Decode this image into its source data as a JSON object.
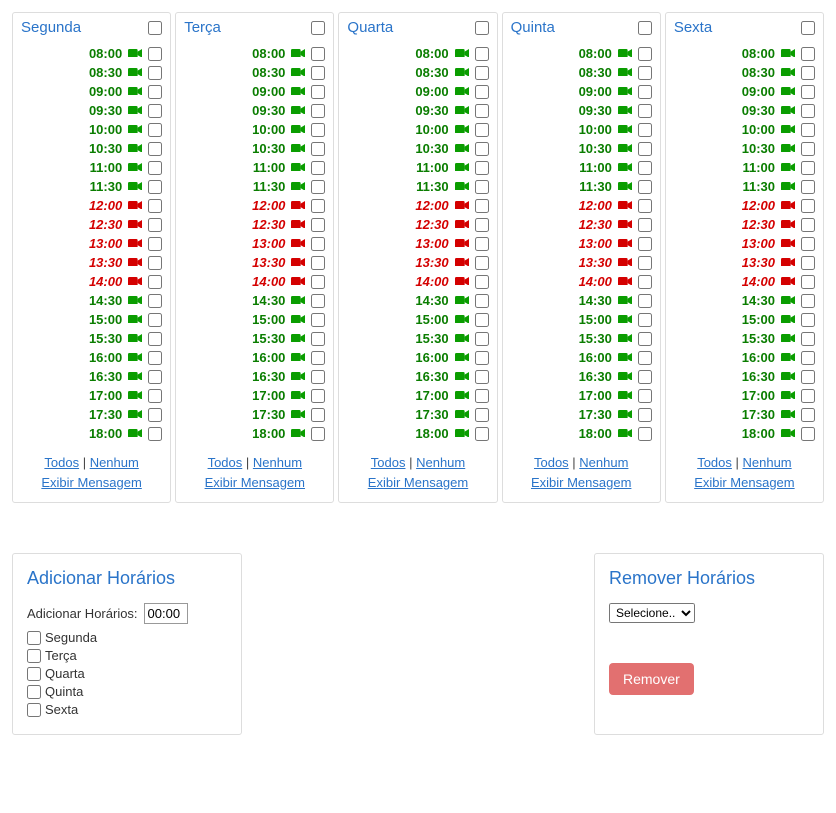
{
  "days": [
    {
      "key": "segunda",
      "label": "Segunda"
    },
    {
      "key": "terca",
      "label": "Terça"
    },
    {
      "key": "quarta",
      "label": "Quarta"
    },
    {
      "key": "quinta",
      "label": "Quinta"
    },
    {
      "key": "sexta",
      "label": "Sexta"
    }
  ],
  "slots": [
    {
      "time": "08:00",
      "status": "green"
    },
    {
      "time": "08:30",
      "status": "green"
    },
    {
      "time": "09:00",
      "status": "green"
    },
    {
      "time": "09:30",
      "status": "green"
    },
    {
      "time": "10:00",
      "status": "green"
    },
    {
      "time": "10:30",
      "status": "green"
    },
    {
      "time": "11:00",
      "status": "green"
    },
    {
      "time": "11:30",
      "status": "green"
    },
    {
      "time": "12:00",
      "status": "red"
    },
    {
      "time": "12:30",
      "status": "red"
    },
    {
      "time": "13:00",
      "status": "red"
    },
    {
      "time": "13:30",
      "status": "red"
    },
    {
      "time": "14:00",
      "status": "red"
    },
    {
      "time": "14:30",
      "status": "green"
    },
    {
      "time": "15:00",
      "status": "green"
    },
    {
      "time": "15:30",
      "status": "green"
    },
    {
      "time": "16:00",
      "status": "green"
    },
    {
      "time": "16:30",
      "status": "green"
    },
    {
      "time": "17:00",
      "status": "green"
    },
    {
      "time": "17:30",
      "status": "green"
    },
    {
      "time": "18:00",
      "status": "green"
    }
  ],
  "footer": {
    "todos": "Todos",
    "nenhum": "Nenhum",
    "exibir": "Exibir Mensagem"
  },
  "add_panel": {
    "title": "Adicionar Horários",
    "label": "Adicionar Horários:",
    "value": "00:00",
    "options": [
      {
        "key": "segunda",
        "label": "Segunda"
      },
      {
        "key": "terca",
        "label": "Terça"
      },
      {
        "key": "quarta",
        "label": "Quarta"
      },
      {
        "key": "quinta",
        "label": "Quinta"
      },
      {
        "key": "sexta",
        "label": "Sexta"
      }
    ]
  },
  "remove_panel": {
    "title": "Remover Horários",
    "select_placeholder": "Selecione..",
    "button": "Remover"
  }
}
